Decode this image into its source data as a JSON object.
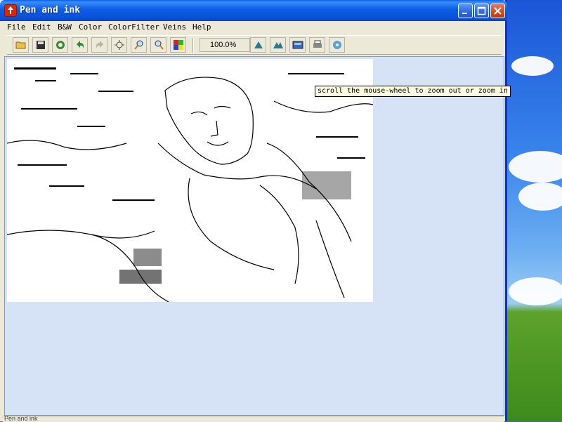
{
  "window": {
    "title": "Pen and ink",
    "icon": "app-pen-icon"
  },
  "titlebar_buttons": [
    "minimize-icon",
    "maximize-icon",
    "close-icon"
  ],
  "menu": {
    "file": "File",
    "edit": "Edit",
    "bw": "B&W",
    "color": "Color",
    "colorfilter": "ColorFilter",
    "veins": "Veins",
    "help": "Help"
  },
  "toolbar": {
    "icons": [
      "open-folder-icon",
      "save-icon",
      "refresh-icon",
      "undo-icon",
      "redo-icon",
      "fit-window-icon",
      "zoom-out-icon",
      "zoom-in-icon",
      "color-palette-icon"
    ],
    "zoom_value": "100.0%",
    "icons_right": [
      "sharpen-icon",
      "sharpen-more-icon",
      "preview-icon",
      "print-icon",
      "settings-icon"
    ]
  },
  "tooltip": {
    "text": "scroll the mouse-wheel to zoom out or zoom in"
  },
  "statusbar": {
    "text": "Pen and ink"
  },
  "colors": {
    "title_blue": "#0a5ff0",
    "client_bg": "#d6e3f7",
    "window_bg": "#ece9d8",
    "tooltip_bg": "#ffffe1"
  }
}
